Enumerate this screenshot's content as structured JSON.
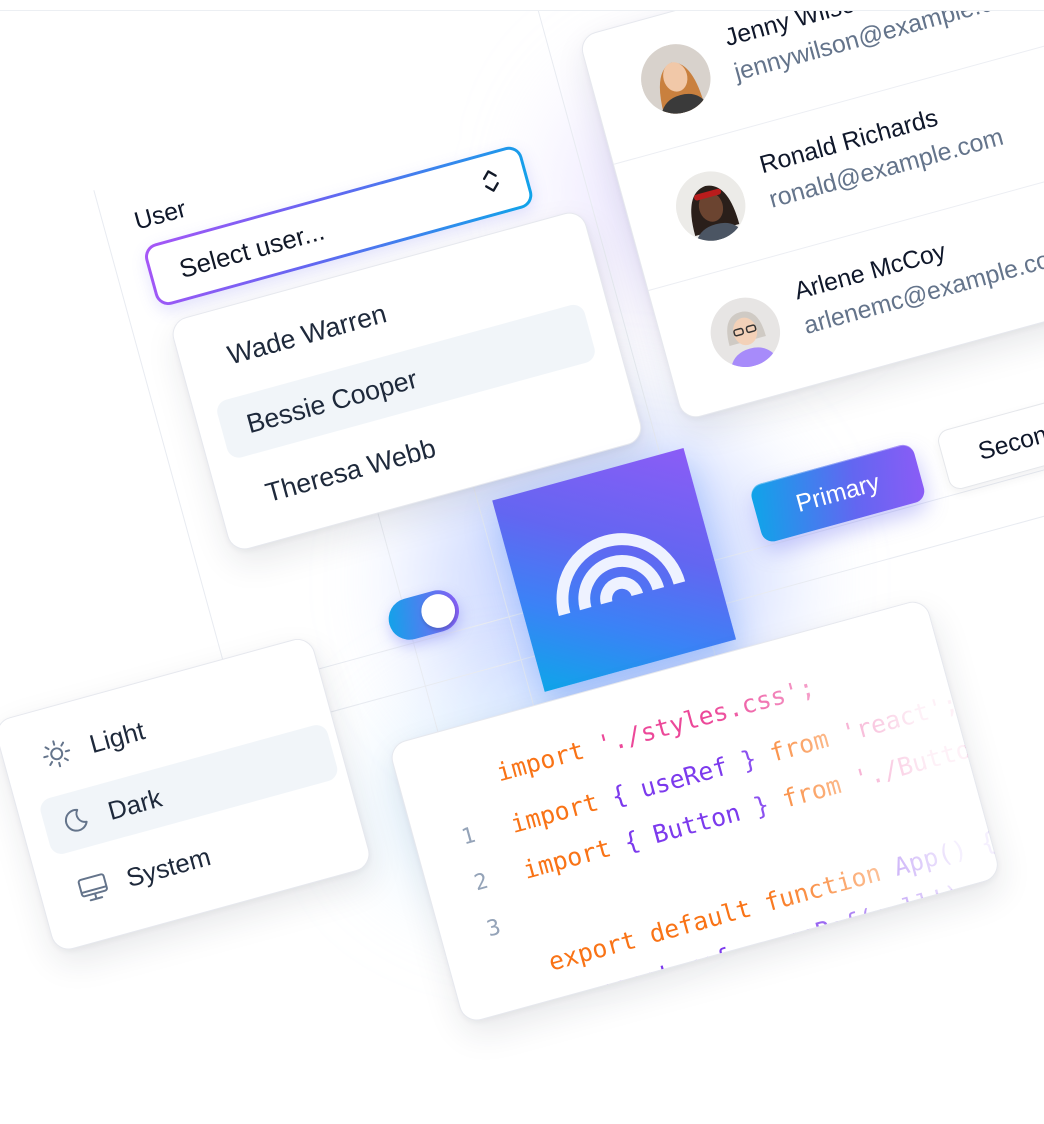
{
  "select": {
    "label": "User",
    "placeholder": "Select user...",
    "options": [
      "Wade Warren",
      "Bessie Cooper",
      "Theresa Webb"
    ],
    "highlighted_index": 1
  },
  "users": [
    {
      "name": "Jenny Wilson",
      "email": "jennywilson@example.com"
    },
    {
      "name": "Ronald Richards",
      "email": "ronald@example.com"
    },
    {
      "name": "Arlene McCoy",
      "email": "arlenemc@example.com"
    }
  ],
  "buttons": {
    "primary": "Primary",
    "secondary": "Secondary"
  },
  "toggle": {
    "on": true
  },
  "theme_menu": {
    "items": [
      {
        "label": "Light",
        "icon": "sun-icon"
      },
      {
        "label": "Dark",
        "icon": "moon-icon"
      },
      {
        "label": "System",
        "icon": "monitor-icon"
      }
    ],
    "highlighted_index": 1
  },
  "code": {
    "line1": {
      "num": "1",
      "kw": "import",
      "rest": "'./styles.css';"
    },
    "line2": {
      "num": "2",
      "kw": "import",
      "brace_open": "{",
      "ident": "useRef",
      "brace_close": "}",
      "from": "from",
      "str": "'react';"
    },
    "line3": {
      "num": "3",
      "kw": "import",
      "brace_open": "{",
      "ident": "Button",
      "brace_close": "}",
      "from": "from",
      "str": "'./Button';"
    },
    "line4": {
      "kw": "export default",
      "fn": "function",
      "name": "App()",
      "brace": "{"
    },
    "line5": {
      "text": "const ref = useRef(null!);"
    }
  },
  "colors": {
    "accent_blue": "#0ea5e9",
    "accent_indigo": "#6366f1",
    "accent_violet": "#8b5cf6",
    "code_keyword": "#f97316",
    "code_string": "#ec4899",
    "code_identifier": "#7c3aed"
  }
}
